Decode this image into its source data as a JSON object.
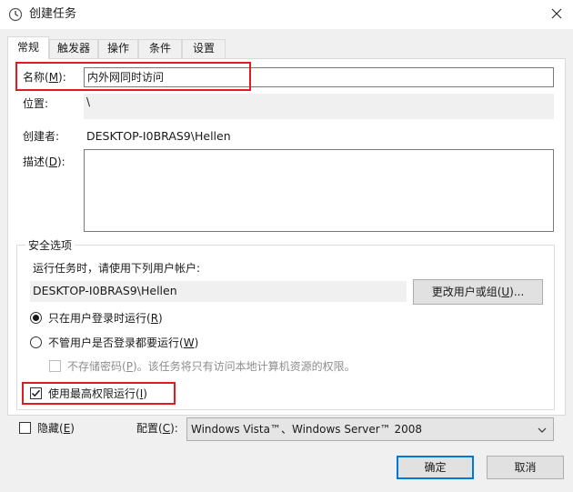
{
  "window": {
    "title": "创建任务",
    "app_icon": "clock-icon",
    "close_icon": "close-icon"
  },
  "tabs": [
    {
      "label": "常规",
      "active": true
    },
    {
      "label": "触发器",
      "active": false
    },
    {
      "label": "操作",
      "active": false
    },
    {
      "label": "条件",
      "active": false
    },
    {
      "label": "设置",
      "active": false
    }
  ],
  "general": {
    "name_label_prefix": "名称(",
    "name_label_key": "M",
    "name_label_suffix": "):",
    "name_value": "内外网同时访问",
    "location_label": "位置:",
    "location_value": "\\",
    "author_label": "创建者:",
    "author_value": "DESKTOP-I0BRAS9\\Hellen",
    "description_label_prefix": "描述(",
    "description_label_key": "D",
    "description_label_suffix": "):",
    "description_value": ""
  },
  "security": {
    "legend": "安全选项",
    "run_as_label": "运行任务时，请使用下列用户帐户:",
    "user_account": "DESKTOP-I0BRAS9\\Hellen",
    "change_user_button_prefix": "更改用户或组(",
    "change_user_button_key": "U",
    "change_user_button_suffix": ")...",
    "radio_logged_on_prefix": "只在用户登录时运行(",
    "radio_logged_on_key": "R",
    "radio_logged_on_suffix": ")",
    "radio_logged_on_selected": true,
    "radio_whether_prefix": "不管用户是否登录都要运行(",
    "radio_whether_key": "W",
    "radio_whether_suffix": ")",
    "radio_whether_selected": false,
    "no_store_password_prefix": "不存储密码(",
    "no_store_password_key": "P",
    "no_store_password_suffix": ")。该任务将只有访问本地计算机资源的权限。",
    "no_store_password_checked": false,
    "highest_privileges_prefix": "使用最高权限运行(",
    "highest_privileges_key": "I",
    "highest_privileges_suffix": ")",
    "highest_privileges_checked": true
  },
  "bottom": {
    "hidden_prefix": "隐藏(",
    "hidden_key": "E",
    "hidden_suffix": ")",
    "hidden_checked": false,
    "configure_label_prefix": "配置(",
    "configure_label_key": "C",
    "configure_label_suffix": "):",
    "configure_value": "Windows Vista™、Windows Server™ 2008",
    "ok_label": "确定",
    "cancel_label": "取消"
  },
  "colors": {
    "highlight": "#e11b22",
    "default_button_border": "#0078d7"
  }
}
